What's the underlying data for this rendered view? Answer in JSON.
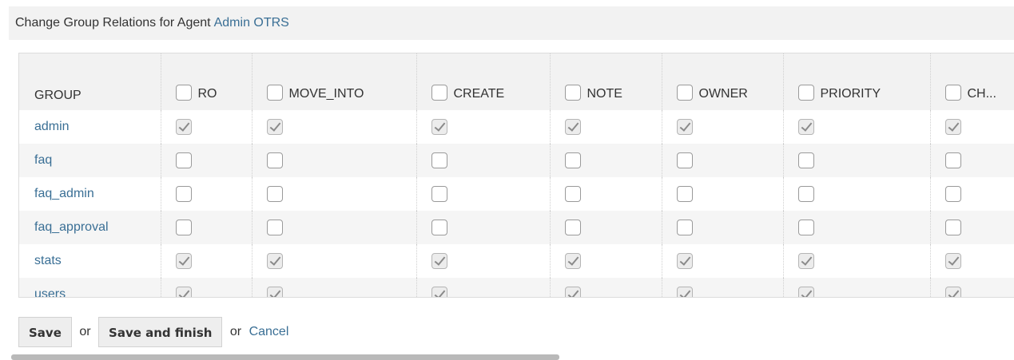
{
  "header": {
    "title_prefix": "Change Group Relations for Agent",
    "agent_name": "Admin OTRS"
  },
  "table": {
    "group_header": "GROUP",
    "permission_columns": [
      "RO",
      "MOVE_INTO",
      "CREATE",
      "NOTE",
      "OWNER",
      "PRIORITY",
      "CH..."
    ],
    "rows": [
      {
        "group": "admin",
        "checked": [
          true,
          true,
          true,
          true,
          true,
          true,
          true
        ]
      },
      {
        "group": "faq",
        "checked": [
          false,
          false,
          false,
          false,
          false,
          false,
          false
        ]
      },
      {
        "group": "faq_admin",
        "checked": [
          false,
          false,
          false,
          false,
          false,
          false,
          false
        ]
      },
      {
        "group": "faq_approval",
        "checked": [
          false,
          false,
          false,
          false,
          false,
          false,
          false
        ]
      },
      {
        "group": "stats",
        "checked": [
          true,
          true,
          true,
          true,
          true,
          true,
          true
        ]
      },
      {
        "group": "users",
        "checked": [
          true,
          true,
          true,
          true,
          true,
          true,
          true
        ]
      }
    ]
  },
  "actions": {
    "save_label": "Save",
    "or_1": "or",
    "save_finish_label": "Save and finish",
    "or_2": "or",
    "cancel_label": "Cancel"
  }
}
